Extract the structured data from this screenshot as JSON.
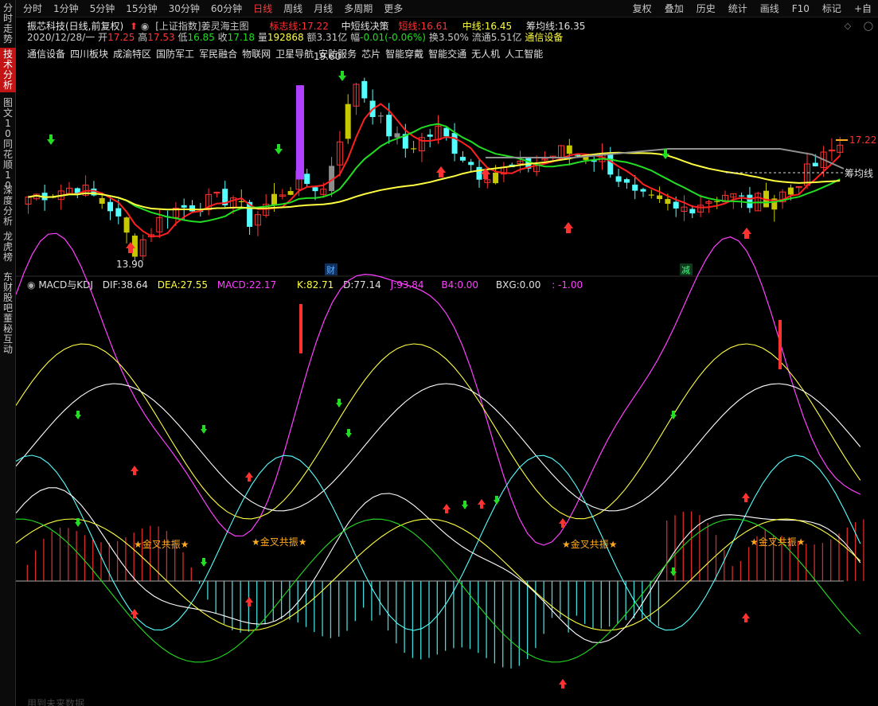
{
  "toolbar": {
    "periods": [
      "分时",
      "1分钟",
      "5分钟",
      "15分钟",
      "30分钟",
      "60分钟",
      "日线",
      "周线",
      "月线",
      "多周期",
      "更多"
    ],
    "active_period": "日线",
    "right": [
      "复权",
      "叠加",
      "历史",
      "统计",
      "画线",
      "F10",
      "标记",
      "+自"
    ]
  },
  "sidebar": [
    {
      "label": "分时走势",
      "active": false
    },
    {
      "label": "技术分析",
      "active": true
    },
    {
      "label": "图文10",
      "active": false
    },
    {
      "label": "同花顺10",
      "active": false
    },
    {
      "label": "深度分析",
      "active": false
    },
    {
      "label": "龙虎榜",
      "active": false
    },
    {
      "label": "东财股吧",
      "active": false
    },
    {
      "label": "董秘互动",
      "active": false
    }
  ],
  "header": {
    "stock_name": "振芯科技(日线,前复权)",
    "index_tag": "[上证指数]姜灵海主图",
    "biaozhi_label": "标志线:",
    "biaozhi_value": "17.22",
    "zhongduan_label": "中短线决策",
    "duanxian_label": "短线:",
    "duanxian_value": "16.61",
    "zhongxian_label": "中线:",
    "zhongxian_value": "16.45",
    "choujun_label": "筹均线:",
    "choujun_value": "16.35"
  },
  "quote": {
    "date": "2020/12/28/一",
    "open_label": "开",
    "open": "17.25",
    "high_label": "高",
    "high": "17.53",
    "low_label": "低",
    "low": "16.85",
    "close_label": "收",
    "close": "17.18",
    "vol_label": "量",
    "vol": "192868",
    "amount_label": "额",
    "amount": "3.31亿",
    "change_label": "幅",
    "change": "-0.01(-0.06%)",
    "turnover_label": "换",
    "turnover": "3.50%",
    "float_label": "流通",
    "float": "5.51亿",
    "industry": "通信设备"
  },
  "concepts": [
    "通信设备",
    "四川板块",
    "成渝特区",
    "国防军工",
    "军民融合",
    "物联网",
    "卫星导航",
    "安防服务",
    "芯片",
    "智能穿戴",
    "智能交通",
    "无人机",
    "人工智能"
  ],
  "macd": {
    "title": "MACD与KDJ",
    "dif_label": "DIF:",
    "dif": "38.64",
    "dea_label": "DEA:",
    "dea": "27.55",
    "macd_label": "MACD:",
    "macd": "22.17",
    "k_label": "K:",
    "k": "82.71",
    "d_label": "D:",
    "d": "77.14",
    "j_label": "J:",
    "j": "93.84",
    "b4_label": "B4:",
    "b4": "0.00",
    "bxg_label": "BXG:",
    "bxg": "0.00",
    "extra": ": -1.00"
  },
  "annotations": {
    "high_price": "19.60",
    "low_price": "13.90",
    "last_price": "17.22",
    "choujun_tag": "筹均线",
    "event_cai": "财",
    "event_jian": "减",
    "golden_cross": "★金叉共振★",
    "footer_note": "用到未来数据"
  },
  "colors": {
    "up": "#ff3232",
    "down": "#54ffff",
    "yellow_candle": "#c8c800",
    "gray_candle": "#8c8c8c",
    "ma_red": "#ff2020",
    "ma_green": "#22dd22",
    "ma_yellow": "#ffff40",
    "ma_gray": "#909090",
    "purple": "#b040ff",
    "magenta": "#ff40ff",
    "white": "#ffffff",
    "orange": "#ffaa20"
  }
}
